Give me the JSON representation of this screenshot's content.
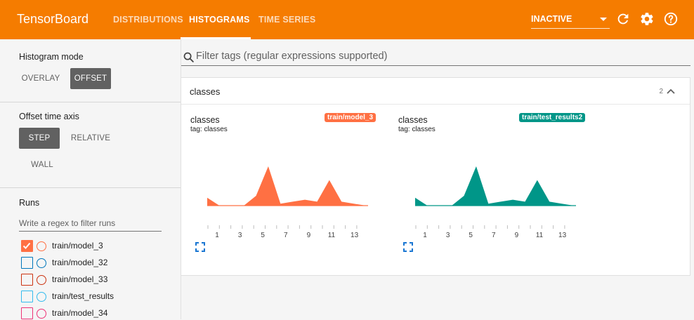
{
  "topbar": {
    "brand": "TensorBoard",
    "tabs": [
      {
        "label": "DISTRIBUTIONS",
        "active": false
      },
      {
        "label": "HISTOGRAMS",
        "active": true
      },
      {
        "label": "TIME SERIES",
        "active": false
      }
    ],
    "run_selector": "INACTIVE",
    "bar_color": "#f57c00"
  },
  "sidebar": {
    "histogram_mode": {
      "label": "Histogram mode",
      "options": [
        {
          "label": "OVERLAY",
          "selected": false
        },
        {
          "label": "OFFSET",
          "selected": true
        }
      ]
    },
    "offset_time_axis": {
      "label": "Offset time axis",
      "options": [
        {
          "label": "STEP",
          "selected": true
        },
        {
          "label": "RELATIVE",
          "selected": false
        },
        {
          "label": "WALL",
          "selected": false
        }
      ]
    },
    "runs": {
      "label": "Runs",
      "filter_placeholder": "Write a regex to filter runs",
      "items": [
        {
          "name": "train/model_3",
          "color": "#ff7043",
          "checked": true
        },
        {
          "name": "train/model_32",
          "color": "#0077bb",
          "checked": false
        },
        {
          "name": "train/model_33",
          "color": "#cc3311",
          "checked": false
        },
        {
          "name": "train/test_results",
          "color": "#33bbee",
          "checked": false
        },
        {
          "name": "train/model_34",
          "color": "#ee3377",
          "checked": false
        }
      ]
    }
  },
  "main": {
    "filter_placeholder": "Filter tags (regular expressions supported)",
    "group": {
      "title": "classes",
      "count": "2",
      "cards": [
        {
          "title": "classes",
          "tag": "tag: classes",
          "run": "train/model_3",
          "color": "#ff7043"
        },
        {
          "title": "classes",
          "tag": "tag: classes",
          "run": "train/test_results2",
          "color": "#009688"
        }
      ]
    }
  },
  "chart_data": [
    {
      "type": "area",
      "title": "classes",
      "series": [
        {
          "name": "train/model_3",
          "x": [
            0,
            1,
            2,
            3,
            4,
            5,
            6,
            7,
            8,
            9,
            10,
            11,
            12,
            13
          ],
          "y": [
            0.2,
            0.0,
            0.0,
            0.0,
            0.25,
            1.0,
            0.05,
            0.1,
            0.15,
            0.1,
            0.65,
            0.1,
            0.05,
            0.0
          ]
        }
      ],
      "xticks": [
        "1",
        "3",
        "5",
        "7",
        "9",
        "11",
        "13"
      ]
    },
    {
      "type": "area",
      "title": "classes",
      "series": [
        {
          "name": "train/test_results2",
          "x": [
            0,
            1,
            2,
            3,
            4,
            5,
            6,
            7,
            8,
            9,
            10,
            11,
            12,
            13
          ],
          "y": [
            0.2,
            0.0,
            0.0,
            0.0,
            0.25,
            1.0,
            0.05,
            0.1,
            0.15,
            0.1,
            0.65,
            0.1,
            0.05,
            0.0
          ]
        }
      ],
      "xticks": [
        "1",
        "3",
        "5",
        "7",
        "9",
        "11",
        "13"
      ]
    }
  ]
}
